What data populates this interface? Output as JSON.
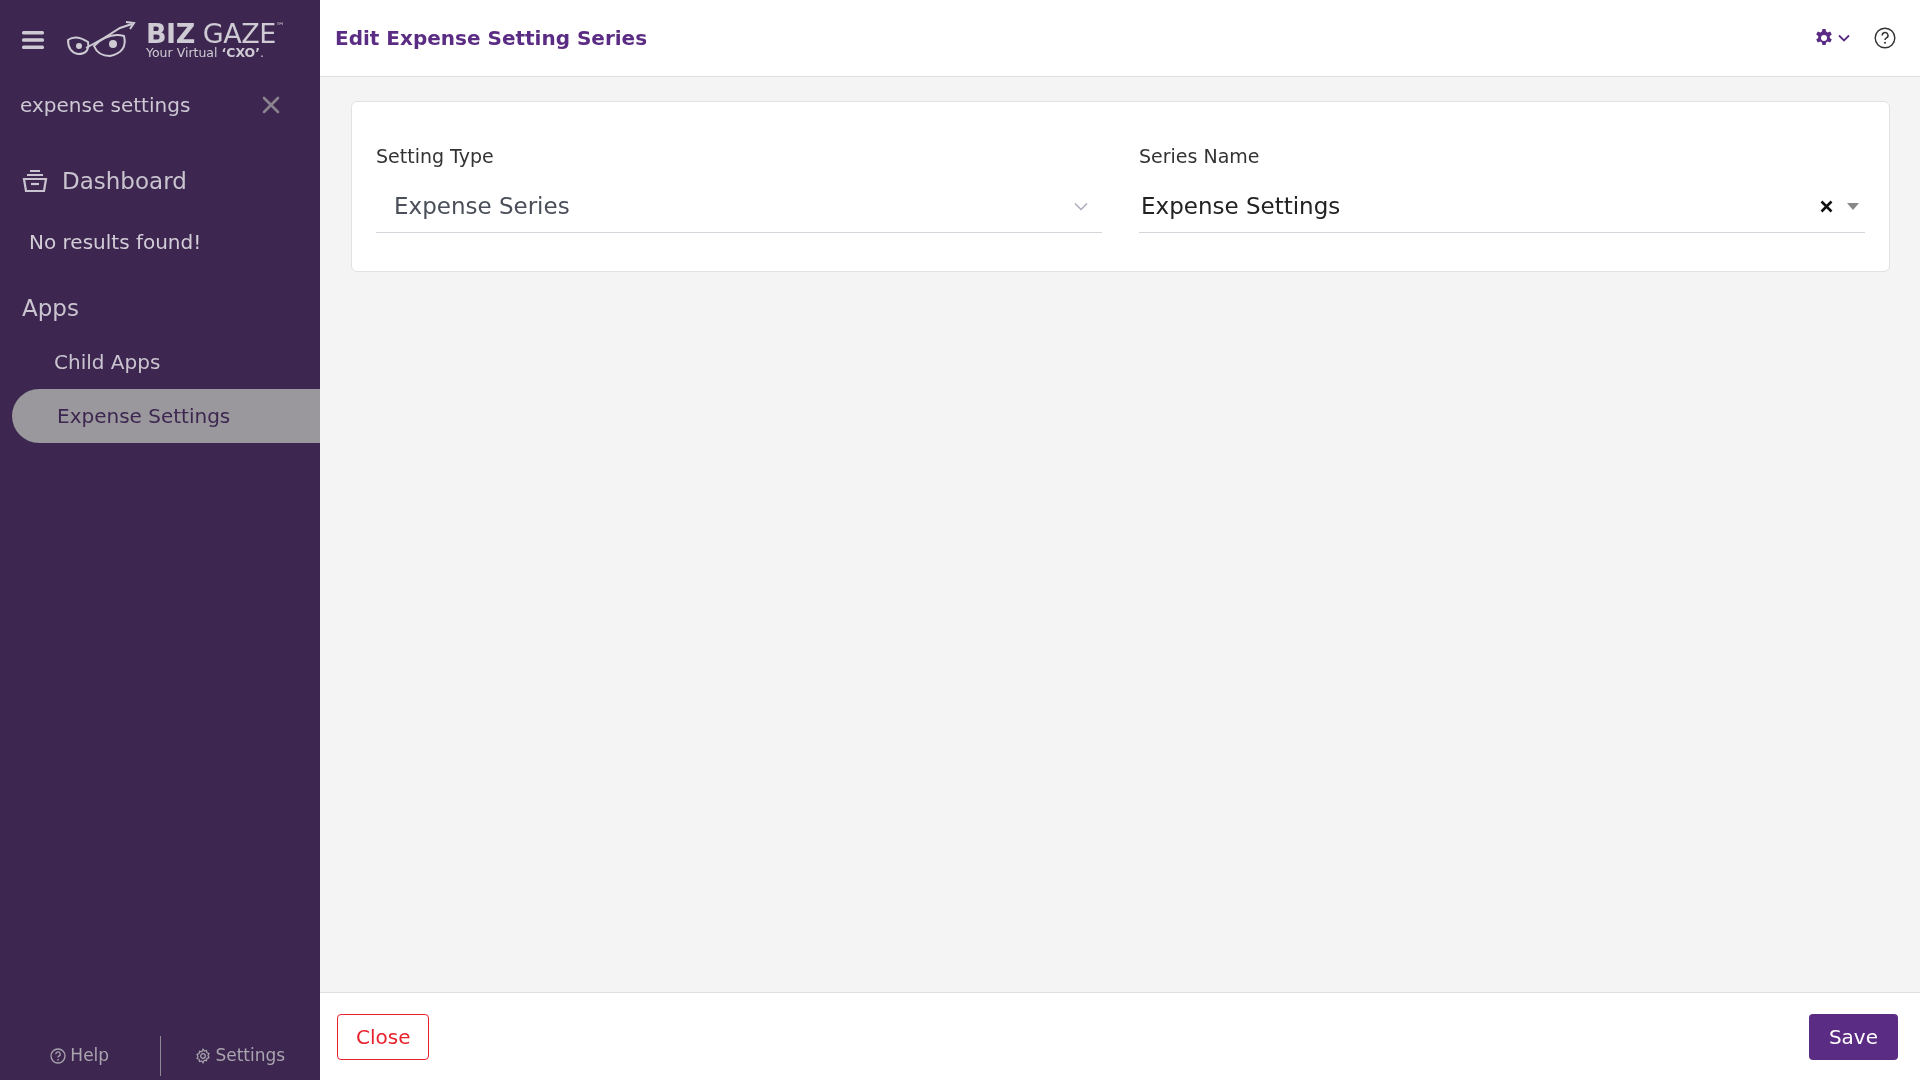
{
  "sidebar": {
    "brand": "**BIZ** GAZE",
    "trademark": "™",
    "tagline": "Your Virtual **‘CXO’**.",
    "search": {
      "value": "expense settings"
    },
    "items": [
      {
        "kind": "module",
        "label": "Dashboard"
      },
      {
        "kind": "message",
        "label": "No results found!"
      },
      {
        "kind": "section",
        "label": "Apps"
      },
      {
        "kind": "link",
        "label": "Child Apps",
        "selected": false
      },
      {
        "kind": "link",
        "label": "Expense Settings",
        "selected": true
      }
    ],
    "footer": [
      {
        "kind": "help",
        "label": "Help"
      },
      {
        "kind": "settings",
        "label": "Settings"
      }
    ]
  },
  "header": {
    "title": "Edit Expense Setting Series"
  },
  "form": {
    "fields": [
      {
        "kind": "select",
        "label": "Setting Type",
        "value": "Expense Series"
      },
      {
        "kind": "combo",
        "label": "Series Name",
        "value": "Expense Settings"
      }
    ]
  },
  "footer": {
    "buttons": [
      {
        "kind": "close",
        "label": "Close"
      },
      {
        "kind": "save",
        "label": "Save"
      }
    ]
  }
}
